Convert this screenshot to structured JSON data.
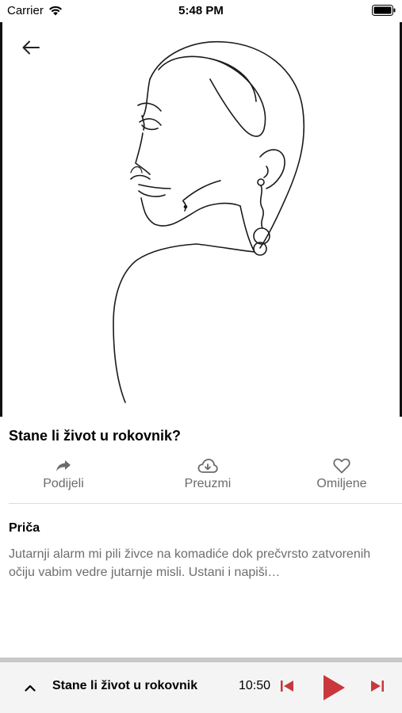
{
  "status": {
    "carrier": "Carrier",
    "time": "5:48 PM"
  },
  "episode": {
    "title": "Stane li život u rokovnik?"
  },
  "actions": {
    "share_label": "Podijeli",
    "download_label": "Preuzmi",
    "favorite_label": "Omiljene"
  },
  "story": {
    "heading": "Priča",
    "text": "Jutarnji alarm mi pili živce na komadiće dok prečvrsto zatvorenih očiju vabim vedre jutarnje misli. Ustani i napiši…"
  },
  "player": {
    "title": "Stane li život u rokovnik",
    "time": "10:50",
    "accent_color": "#c8383d"
  },
  "icons": [
    "wifi-icon",
    "battery-icon",
    "back-arrow-icon",
    "share-icon",
    "cloud-download-icon",
    "heart-icon",
    "chevron-up-icon",
    "skip-previous-icon",
    "play-icon",
    "skip-next-icon"
  ]
}
